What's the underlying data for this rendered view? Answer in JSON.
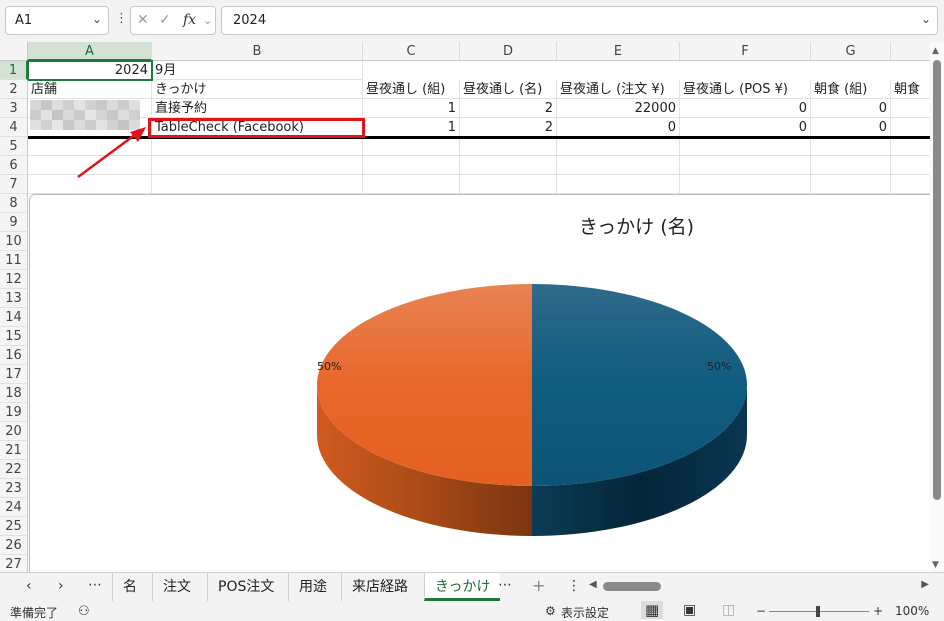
{
  "formula_bar": {
    "cell_ref": "A1",
    "value": "2024",
    "fx": "fx"
  },
  "columns": [
    "A",
    "B",
    "C",
    "D",
    "E",
    "F",
    "G"
  ],
  "rows": [
    "1",
    "2",
    "3",
    "4",
    "5",
    "6",
    "7",
    "8",
    "9",
    "10",
    "11",
    "12",
    "13",
    "14",
    "15",
    "16",
    "17",
    "18",
    "19",
    "20",
    "21",
    "22",
    "23",
    "24",
    "25",
    "26",
    "27"
  ],
  "cells": {
    "a1": "2024",
    "b1": "9月",
    "a2": "店舗",
    "b2": "きっかけ",
    "c2": "昼夜通し (組)",
    "d2": "昼夜通し (名)",
    "e2": "昼夜通し (注文 ¥)",
    "f2": "昼夜通し (POS ¥)",
    "g2": "朝食 (組)",
    "h2": "朝食",
    "b3": "直接予約",
    "c3": "1",
    "d3": "2",
    "e3": "22000",
    "f3": "0",
    "g3": "0",
    "b4": "TableCheck (Facebook)",
    "c4": "1",
    "d4": "2",
    "e4": "0",
    "f4": "0",
    "g4": "0"
  },
  "chart_data": {
    "type": "pie",
    "title": "きっかけ (名)",
    "categories": [
      "直接予約",
      "TableCheck (Facebook)"
    ],
    "values": [
      2,
      2
    ],
    "data_labels": [
      "50%",
      "50%"
    ],
    "colors": [
      "#0f5c80",
      "#e8672a"
    ],
    "style": "3d"
  },
  "sheet_tabs": {
    "nav_prev": "‹",
    "nav_next": "›",
    "more_left": "⋯",
    "tabs": [
      "名",
      "注文",
      "POS注文",
      "用途",
      "来店経路",
      "きっかけ"
    ],
    "active_tab": "きっかけ",
    "more_right": "⋯",
    "add": "+",
    "options": "⋮"
  },
  "status_bar": {
    "ready": "準備完了",
    "display_settings": "表示設定",
    "zoom_minus": "−",
    "zoom_plus": "+",
    "zoom": "100%"
  }
}
